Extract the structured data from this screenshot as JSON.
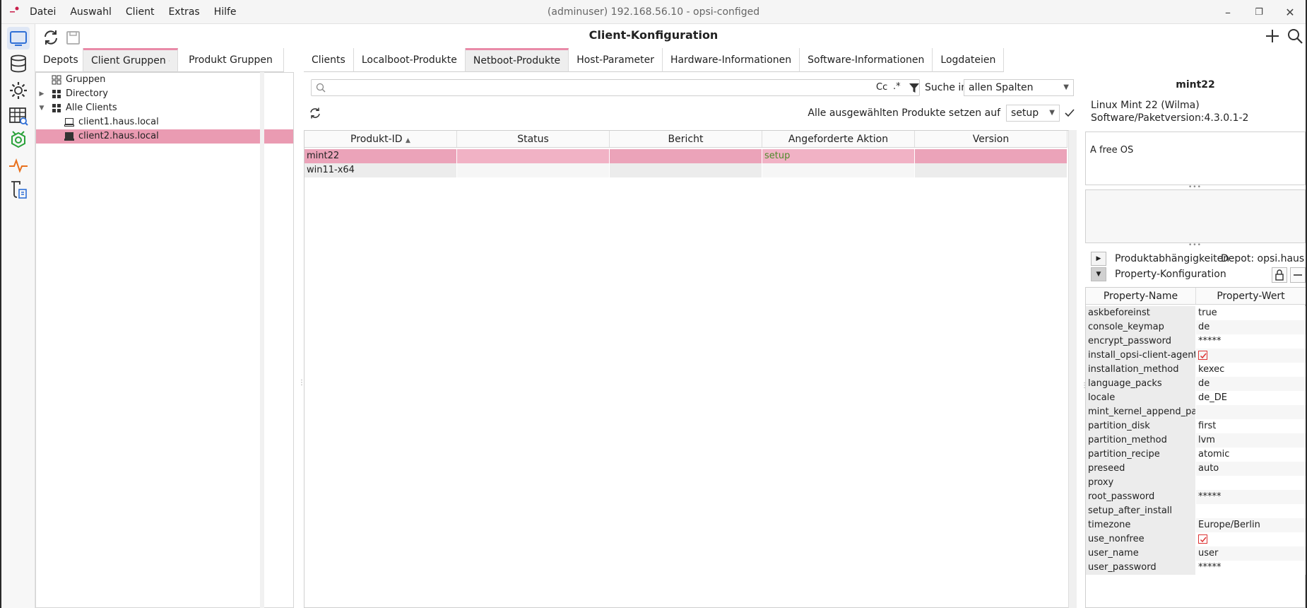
{
  "window": {
    "title": "(adminuser) 192.168.56.10 - opsi-configed",
    "menu": [
      "Datei",
      "Auswahl",
      "Client",
      "Extras",
      "Hilfe"
    ]
  },
  "page_title": "Client-Konfiguration",
  "left_tabs": [
    {
      "label": "Depots",
      "active": false
    },
    {
      "label": "Client Gruppen",
      "active": true
    },
    {
      "label": "Produkt Gruppen",
      "active": false
    }
  ],
  "tree": [
    {
      "label": "Gruppen",
      "icon": "groups-icon",
      "selected": false
    },
    {
      "label": "Directory",
      "icon": "directory-icon",
      "selected": false
    },
    {
      "label": "Alle Clients",
      "icon": "all-clients-icon",
      "selected": false
    },
    {
      "label": "client1.haus.local",
      "icon": "client-icon",
      "selected": false
    },
    {
      "label": "client2.haus.local",
      "icon": "client-icon",
      "selected": true
    }
  ],
  "main_tabs": [
    {
      "label": "Clients",
      "active": false
    },
    {
      "label": "Localboot-Produkte",
      "active": false
    },
    {
      "label": "Netboot-Produkte",
      "active": true
    },
    {
      "label": "Host-Parameter",
      "active": false
    },
    {
      "label": "Hardware-Informationen",
      "active": false
    },
    {
      "label": "Software-Informationen",
      "active": false
    },
    {
      "label": "Logdateien",
      "active": false
    }
  ],
  "search": {
    "value": "",
    "cc_label": "Cc",
    "regex_label": ".*",
    "search_in_label": "Suche in",
    "search_in_value": "allen Spalten"
  },
  "set_all": {
    "label": "Alle ausgewählten Produkte setzen auf",
    "value": "setup"
  },
  "product_table": {
    "columns": [
      "Produkt-ID",
      "Status",
      "Bericht",
      "Angeforderte Aktion",
      "Version"
    ],
    "sort_indicator": "▲",
    "rows": [
      {
        "id": "mint22",
        "status": "",
        "report": "",
        "action": "setup",
        "version": "",
        "selected": true
      },
      {
        "id": "win11-x64",
        "status": "",
        "report": "",
        "action": "",
        "version": "",
        "selected": false
      }
    ]
  },
  "detail": {
    "product_name": "mint22",
    "product_full_name": "Linux Mint 22 (Wilma)",
    "version_line": "Software/Paketversion:4.3.0.1-2",
    "description": "A free OS",
    "dependencies_label": "Produktabhängigkeiten",
    "depot_label": "Depot: opsi.haus.l...",
    "property_config_label": "Property-Konfiguration"
  },
  "property_table": {
    "columns": [
      "Property-Name",
      "Property-Wert"
    ],
    "rows": [
      {
        "name": "askbeforeinst",
        "value": "true",
        "checkbox": false
      },
      {
        "name": "console_keymap",
        "value": "de",
        "checkbox": false
      },
      {
        "name": "encrypt_password",
        "value": "*****",
        "checkbox": false
      },
      {
        "name": "install_opsi-client-agent",
        "value": "",
        "checkbox": true
      },
      {
        "name": "installation_method",
        "value": "kexec",
        "checkbox": false
      },
      {
        "name": "language_packs",
        "value": "de",
        "checkbox": false
      },
      {
        "name": "locale",
        "value": "de_DE",
        "checkbox": false
      },
      {
        "name": "mint_kernel_append_pa...",
        "value": "",
        "checkbox": false
      },
      {
        "name": "partition_disk",
        "value": "first",
        "checkbox": false
      },
      {
        "name": "partition_method",
        "value": "lvm",
        "checkbox": false
      },
      {
        "name": "partition_recipe",
        "value": "atomic",
        "checkbox": false
      },
      {
        "name": "preseed",
        "value": "auto",
        "checkbox": false
      },
      {
        "name": "proxy",
        "value": "",
        "checkbox": false
      },
      {
        "name": "root_password",
        "value": "*****",
        "checkbox": false
      },
      {
        "name": "setup_after_install",
        "value": "",
        "checkbox": false
      },
      {
        "name": "timezone",
        "value": "Europe/Berlin",
        "checkbox": false
      },
      {
        "name": "use_nonfree",
        "value": "",
        "checkbox": true
      },
      {
        "name": "user_name",
        "value": "user",
        "checkbox": false
      },
      {
        "name": "user_password",
        "value": "*****",
        "checkbox": false
      }
    ]
  },
  "colors": {
    "selection": "#ea9bb2",
    "accent": "#e98ba8",
    "action_text": "#4e8a2b"
  }
}
